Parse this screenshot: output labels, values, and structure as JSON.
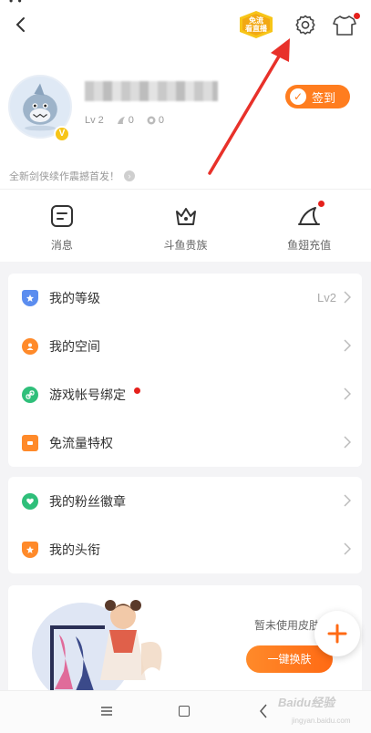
{
  "header": {
    "free_badge_line1": "免流",
    "free_badge_line2": "看直播",
    "username_hidden": true,
    "level": "Lv 2",
    "fish_ball": "0",
    "fish_fin": "0",
    "checkin_label": "签到",
    "announcement": "全新剑侠续作震撼首发！"
  },
  "quick_actions": [
    {
      "label": "消息",
      "icon": "message-icon"
    },
    {
      "label": "斗鱼贵族",
      "icon": "crown-icon"
    },
    {
      "label": "鱼翅充值",
      "icon": "fin-icon"
    }
  ],
  "menu_group1": [
    {
      "label": "我的等级",
      "value": "Lv2",
      "icon": "level-badge-icon",
      "color": "#5b8def"
    },
    {
      "label": "我的空间",
      "value": "",
      "icon": "user-space-icon",
      "color": "#ff8a2a"
    },
    {
      "label": "游戏帐号绑定",
      "value": "",
      "icon": "link-icon",
      "color": "#2fbf7a"
    },
    {
      "label": "免流量特权",
      "value": "",
      "icon": "traffic-icon",
      "color": "#ff8a2a"
    }
  ],
  "menu_group2": [
    {
      "label": "我的粉丝徽章",
      "value": "",
      "icon": "fan-badge-icon",
      "color": "#2fbf7a"
    },
    {
      "label": "我的头衔",
      "value": "",
      "icon": "title-icon",
      "color": "#ff8a2a"
    }
  ],
  "skin": {
    "status_text": "暂未使用皮肤",
    "button_label": "一键换肤"
  },
  "watermark": {
    "text": "Baidu经验",
    "sub": "jingyan.baidu.com"
  },
  "colors": {
    "accent": "#ff7d1f",
    "notify_dot": "#e5201b",
    "annotation": "#e8312a"
  }
}
